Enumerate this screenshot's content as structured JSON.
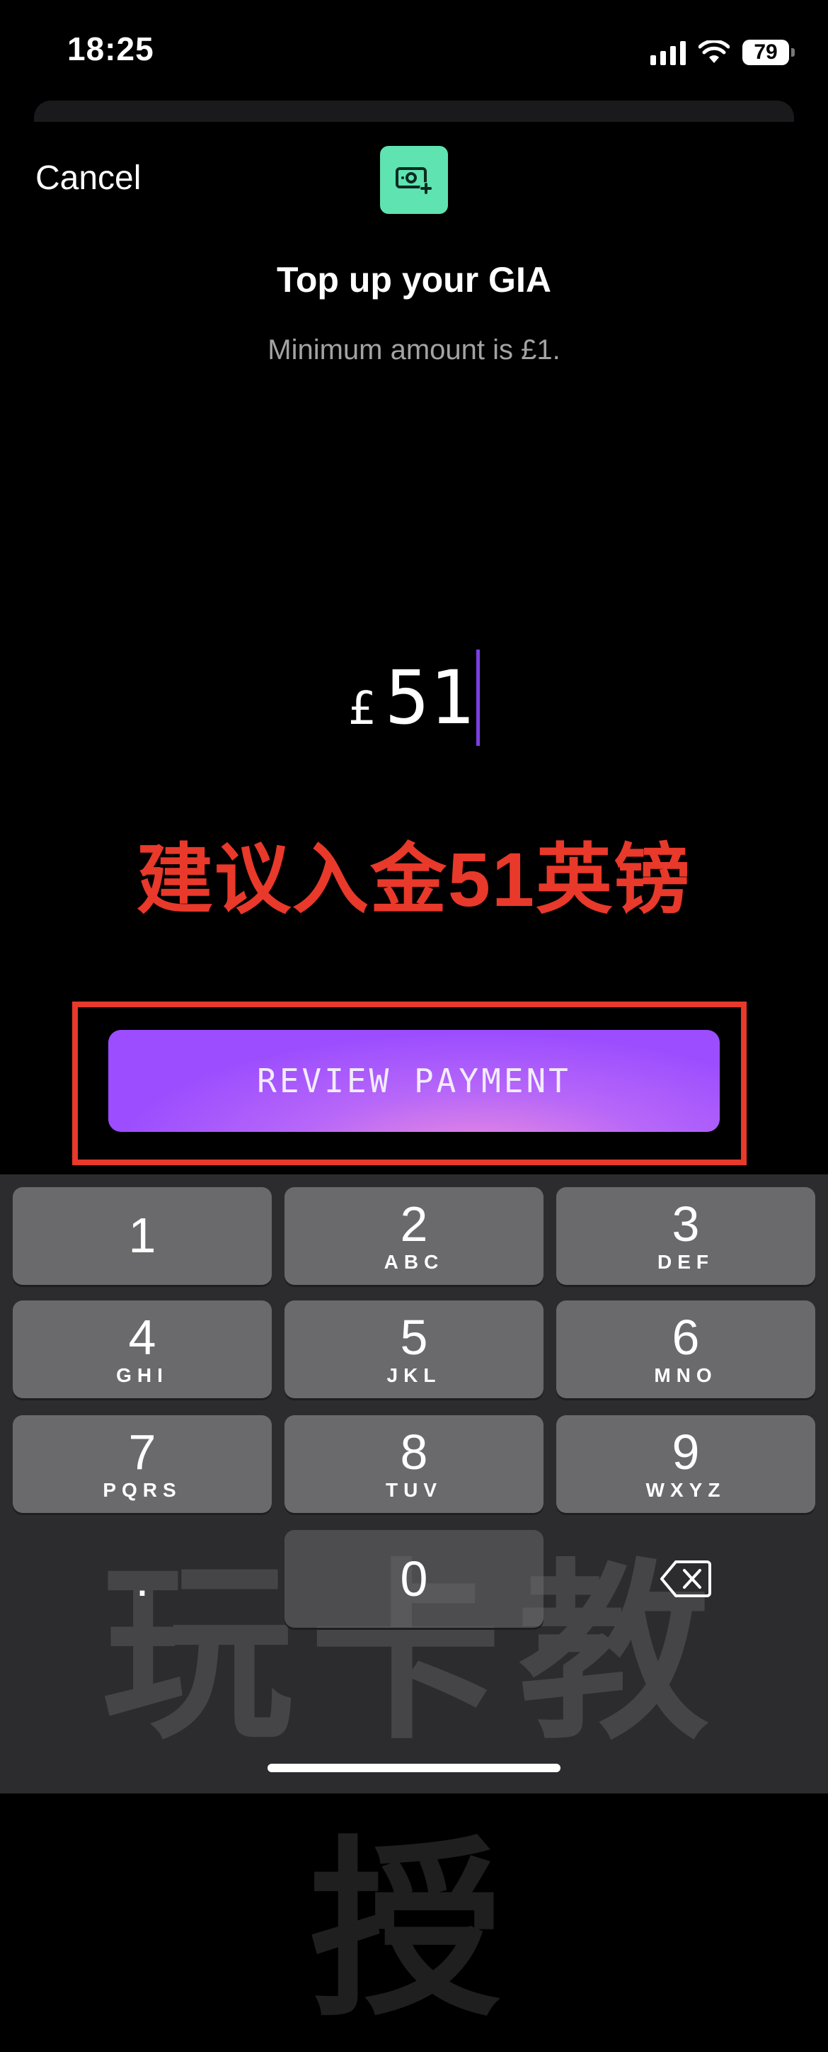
{
  "status_bar": {
    "time": "18:25",
    "battery": "79"
  },
  "header": {
    "cancel_label": "Cancel",
    "title": "Top up your GIA",
    "subtitle": "Minimum amount is £1."
  },
  "amount": {
    "currency": "£",
    "value": "51"
  },
  "annotation": {
    "text": "建议入金51英镑",
    "color": "#e8392b"
  },
  "cta": {
    "label": "REVIEW PAYMENT"
  },
  "keypad": {
    "keys": [
      {
        "digit": "1",
        "letters": ""
      },
      {
        "digit": "2",
        "letters": "ABC"
      },
      {
        "digit": "3",
        "letters": "DEF"
      },
      {
        "digit": "4",
        "letters": "GHI"
      },
      {
        "digit": "5",
        "letters": "JKL"
      },
      {
        "digit": "6",
        "letters": "MNO"
      },
      {
        "digit": "7",
        "letters": "PQRS"
      },
      {
        "digit": "8",
        "letters": "TUV"
      },
      {
        "digit": "9",
        "letters": "WXYZ"
      },
      {
        "digit": "0",
        "letters": ""
      }
    ],
    "decimal": "."
  },
  "watermark": "玩卡教授",
  "colors": {
    "accent_purple": "#9b4dff",
    "icon_badge": "#5ee3b1",
    "keypad_bg": "#2c2c2e"
  }
}
